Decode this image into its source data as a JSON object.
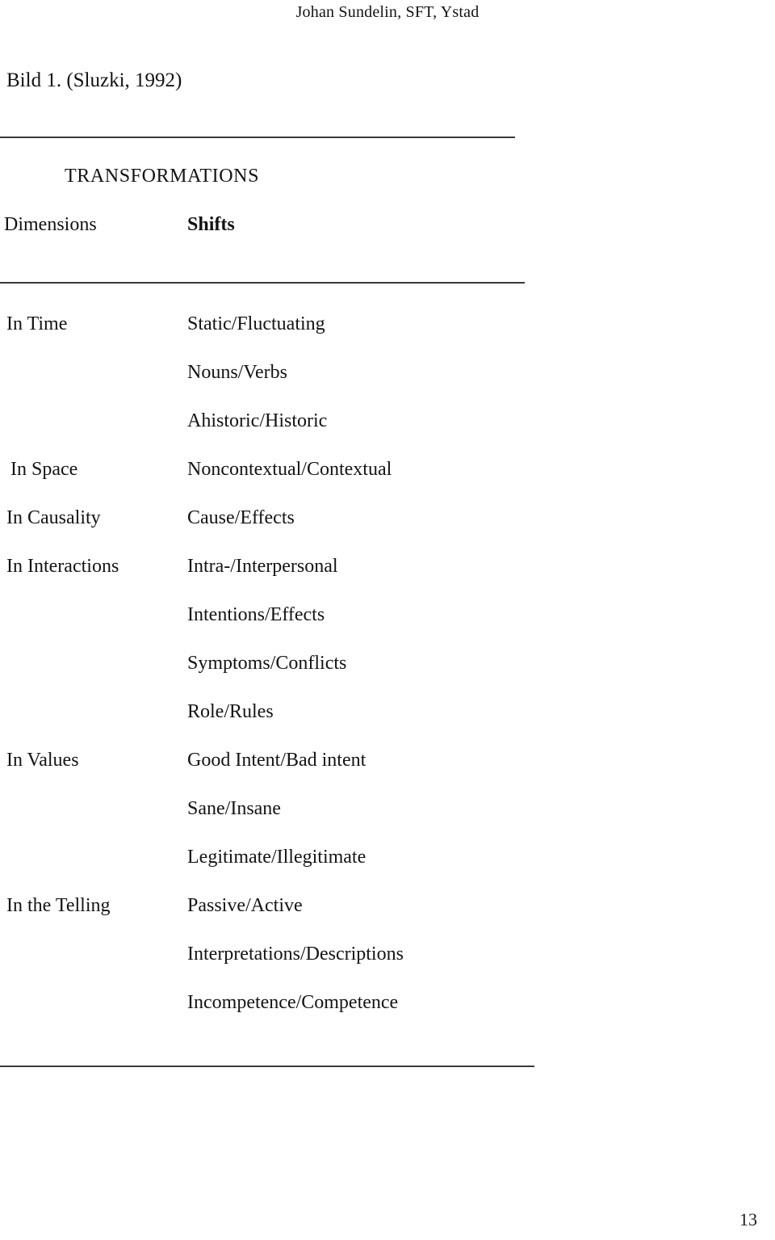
{
  "header": {
    "running_head": "Johan Sundelin, SFT, Ystad"
  },
  "figure": {
    "caption": "Bild 1. (Sluzki, 1992)"
  },
  "table": {
    "title": "TRANSFORMATIONS",
    "columns": {
      "dimensions": "Dimensions",
      "shifts": "Shifts"
    },
    "rows": [
      {
        "dimension": "In Time",
        "shift": "Static/Fluctuating",
        "indented": false
      },
      {
        "dimension": "",
        "shift": "Nouns/Verbs",
        "indented": false
      },
      {
        "dimension": "",
        "shift": "Ahistoric/Historic",
        "indented": false
      },
      {
        "dimension": "In Space",
        "shift": "Noncontextual/Contextual",
        "indented": true
      },
      {
        "dimension": "In Causality",
        "shift": "Cause/Effects",
        "indented": false
      },
      {
        "dimension": "In Interactions",
        "shift": "Intra-/Interpersonal",
        "indented": false
      },
      {
        "dimension": "",
        "shift": "Intentions/Effects",
        "indented": false
      },
      {
        "dimension": "",
        "shift": "Symptoms/Conflicts",
        "indented": false
      },
      {
        "dimension": "",
        "shift": "Role/Rules",
        "indented": false
      },
      {
        "dimension": "In Values",
        "shift": "Good Intent/Bad intent",
        "indented": false
      },
      {
        "dimension": "",
        "shift": "Sane/Insane",
        "indented": false
      },
      {
        "dimension": "",
        "shift": "Legitimate/Illegitimate",
        "indented": false
      },
      {
        "dimension": "In the Telling",
        "shift": "Passive/Active",
        "indented": false
      },
      {
        "dimension": "",
        "shift": "Interpretations/Descriptions",
        "indented": false
      },
      {
        "dimension": "",
        "shift": "Incompetence/Competence",
        "indented": false
      }
    ]
  },
  "footer": {
    "page_number": "13"
  }
}
